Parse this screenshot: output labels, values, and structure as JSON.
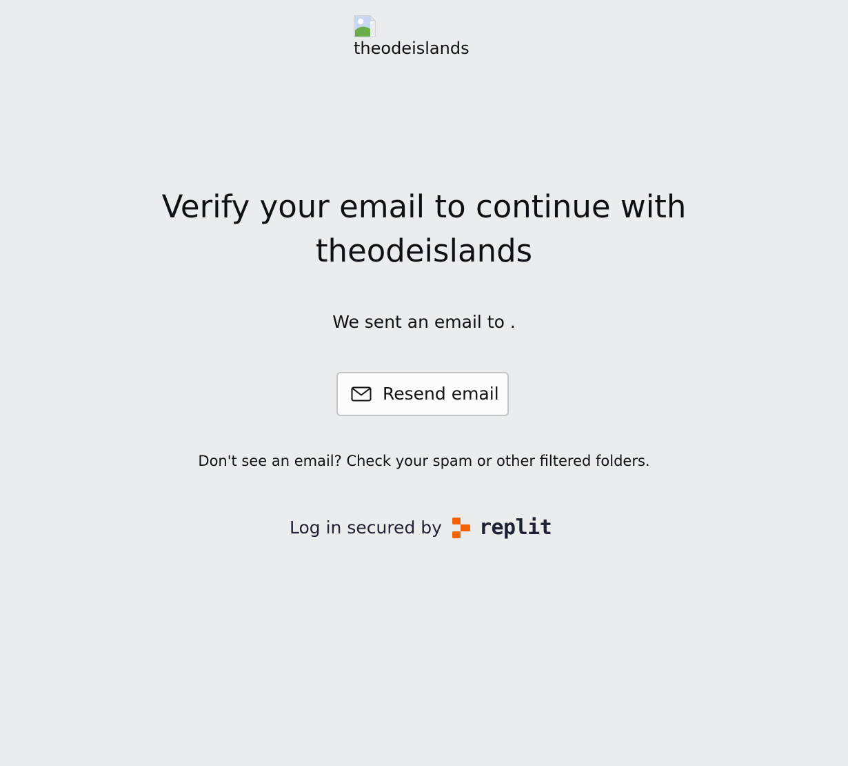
{
  "header": {
    "logo_alt": "theodeislands",
    "logo_icon": "broken-image-icon"
  },
  "main": {
    "title_line1": "Verify your email to continue with",
    "title_line2": "theodeislands",
    "sent_message": "We sent an email to .",
    "resend_button": {
      "label": "Resend email",
      "icon": "mail-icon"
    },
    "hint": "Don't see an email? Check your spam or other filtered folders."
  },
  "footer": {
    "secured_by": "Log in secured by",
    "brand": "replit",
    "brand_icon": "replit-logo-icon",
    "brand_color": "#f26207"
  },
  "colors": {
    "background": "#ebecee",
    "text": "#0e1015",
    "button_bg": "#fcfcfc",
    "button_border": "#c3c5ca"
  }
}
